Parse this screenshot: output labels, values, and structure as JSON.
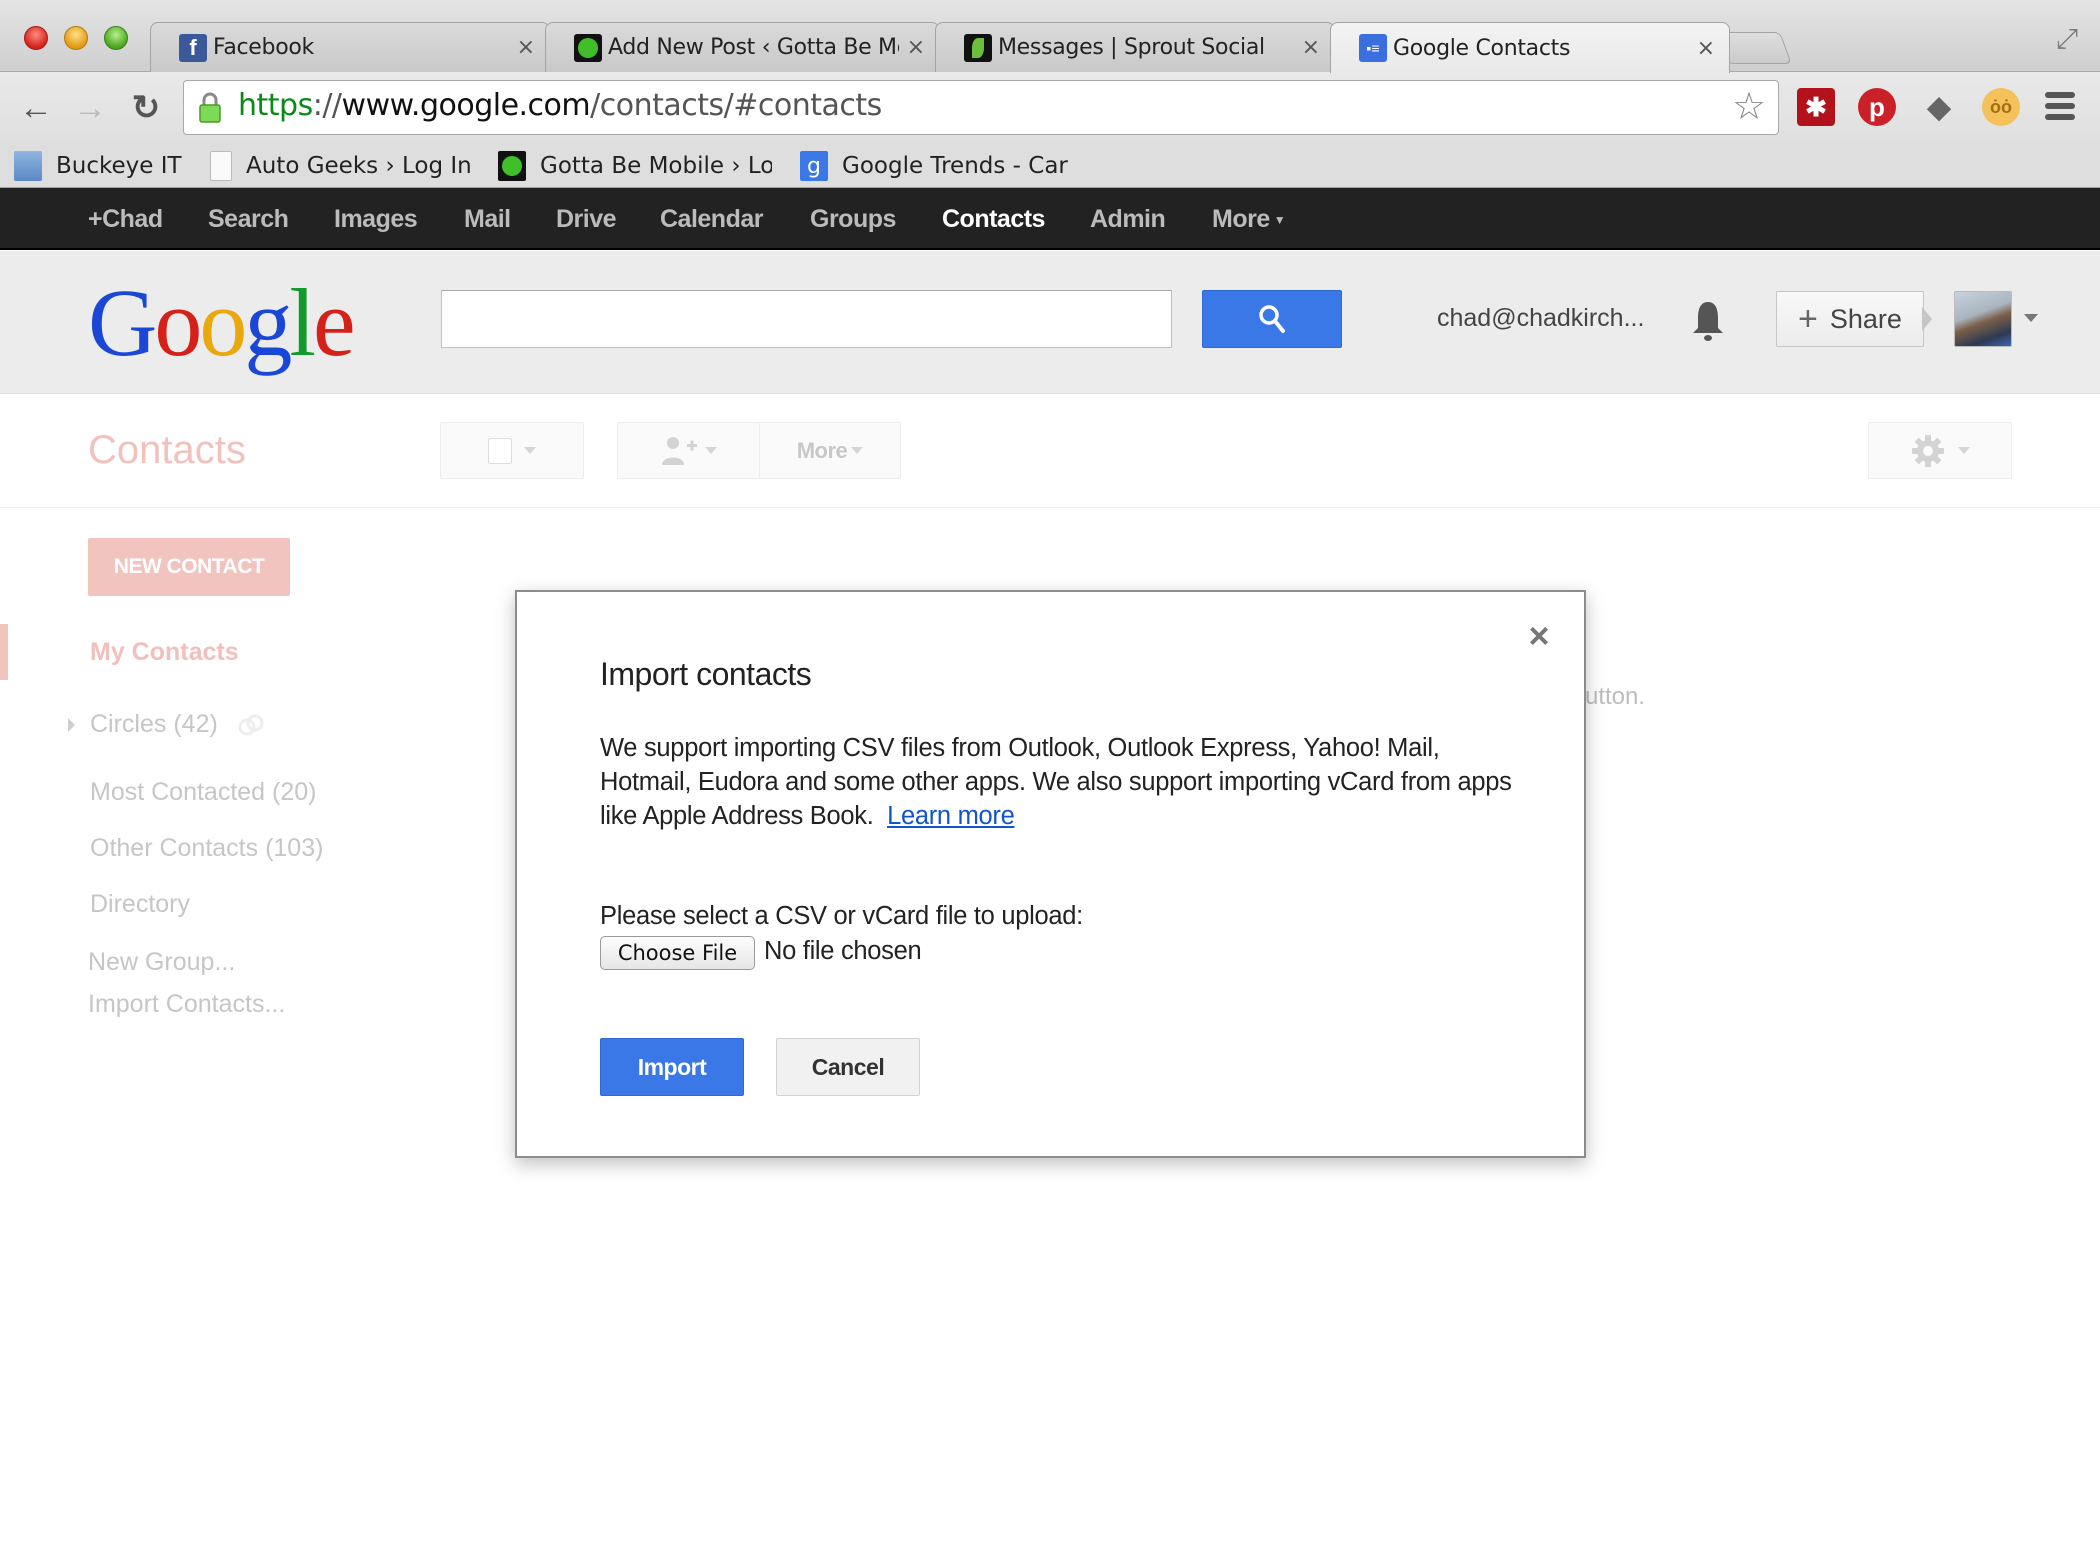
{
  "browser": {
    "tabs": [
      {
        "title": "Facebook",
        "favicon": "facebook-icon",
        "active": false
      },
      {
        "title": "Add New Post ‹ Gotta Be Mobile",
        "favicon": "gotta-be-mobile-icon",
        "active": false
      },
      {
        "title": "Messages | Sprout Social",
        "favicon": "sprout-social-icon",
        "active": false
      },
      {
        "title": "Google Contacts",
        "favicon": "google-contacts-icon",
        "active": true
      }
    ],
    "close_glyph": "×",
    "url": {
      "scheme": "https",
      "separator": "://",
      "host": "www.google.com",
      "path": "/contacts/#contacts"
    },
    "extensions": [
      "lastpass-icon",
      "pinterest-icon",
      "evernote-icon",
      "owl-icon"
    ],
    "bookmarks": [
      {
        "label": "Buckeye IT",
        "icon": "folder-icon"
      },
      {
        "label": "Auto Geeks › Log In",
        "icon": "page-icon"
      },
      {
        "label": "Gotta Be Mobile › Log",
        "icon": "gotta-be-mobile-icon"
      },
      {
        "label": "Google Trends - Car",
        "icon": "google-icon"
      }
    ]
  },
  "gbar": {
    "items": [
      {
        "label": "+Chad"
      },
      {
        "label": "Search"
      },
      {
        "label": "Images"
      },
      {
        "label": "Mail"
      },
      {
        "label": "Drive"
      },
      {
        "label": "Calendar"
      },
      {
        "label": "Groups"
      },
      {
        "label": "Contacts",
        "active": true
      },
      {
        "label": "Admin"
      },
      {
        "label": "More"
      }
    ]
  },
  "header": {
    "logo_letters": [
      "G",
      "o",
      "o",
      "g",
      "l",
      "e"
    ],
    "search_value": "",
    "account_email": "chad@chadkirch...",
    "share_label": "Share"
  },
  "contacts": {
    "title": "Contacts",
    "more_label": "More",
    "new_contact_label": "NEW CONTACT",
    "sidebar": [
      {
        "label": "My Contacts",
        "active": true
      },
      {
        "label": "Circles (42)"
      },
      {
        "label": "Most Contacted (20)"
      },
      {
        "label": "Other Contacts (103)"
      },
      {
        "label": "Directory"
      },
      {
        "label": "New Group..."
      },
      {
        "label": "Import Contacts..."
      }
    ],
    "background_hint": "utton."
  },
  "modal": {
    "title": "Import contacts",
    "close_glyph": "×",
    "body": "We support importing CSV files from Outlook, Outlook Express, Yahoo! Mail, Hotmail, Eudora and some other apps. We also support importing vCard from apps like Apple Address Book.",
    "learn_more": "Learn more",
    "upload_label": "Please select a CSV or vCard file to upload:",
    "choose_file_label": "Choose File",
    "file_status": "No file chosen",
    "import_label": "Import",
    "cancel_label": "Cancel"
  },
  "colors": {
    "google_blue": "#3b78e7",
    "link": "#1155cc",
    "contacts_accent_dimmed": "#f2c4c0",
    "gbar_bg": "#222222"
  }
}
